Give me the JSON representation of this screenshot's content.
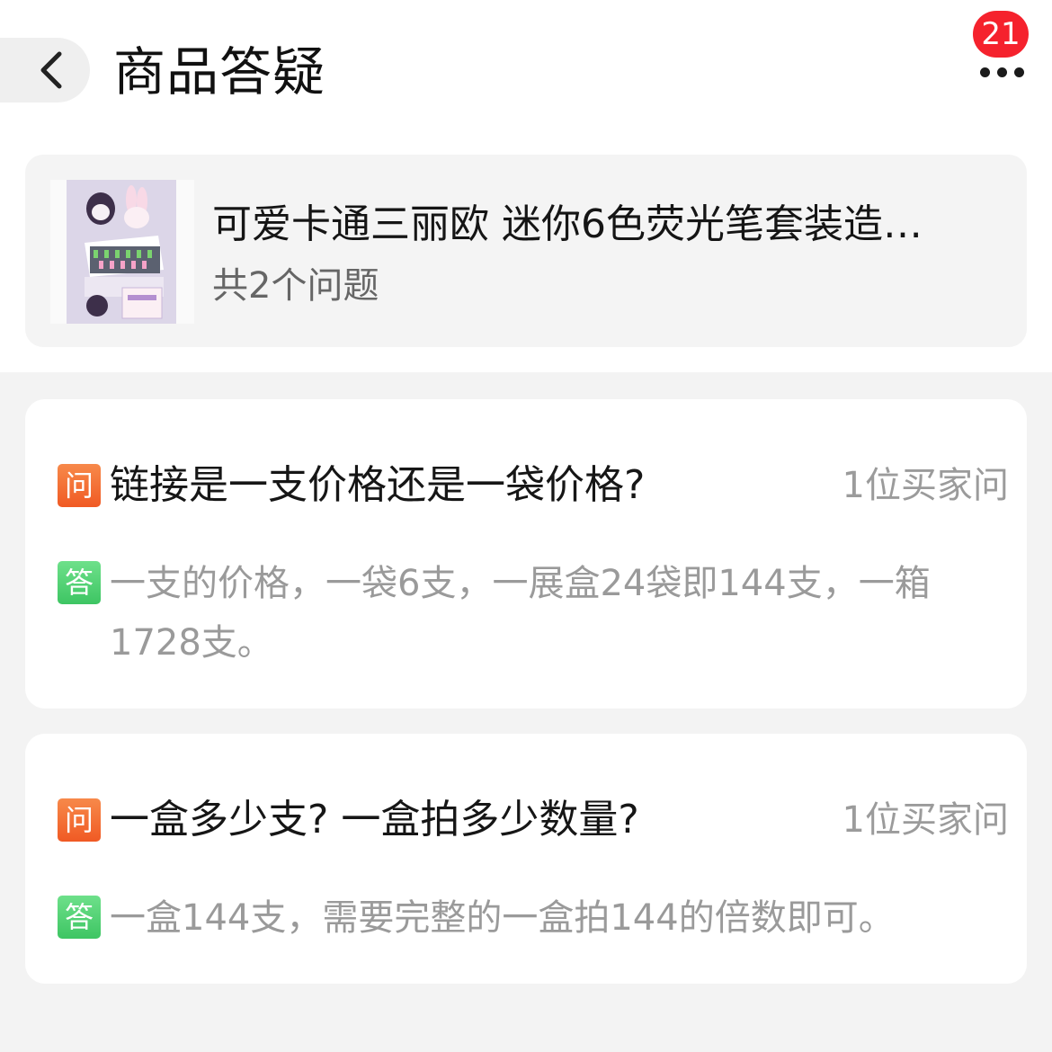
{
  "header": {
    "title": "商品答疑",
    "notification_count": "21"
  },
  "product": {
    "title": "可爱卡通三丽欧 迷你6色荧光笔套装造…",
    "question_count": "共2个问题"
  },
  "qa_items": [
    {
      "q_tag": "问",
      "question": "链接是一支价格还是一袋价格?",
      "asker": "1位买家问",
      "a_tag": "答",
      "answer": "一支的价格，一袋6支，一展盒24袋即144支，一箱1728支。"
    },
    {
      "q_tag": "问",
      "question": "一盒多少支? 一盒拍多少数量?",
      "asker": "1位买家问",
      "a_tag": "答",
      "answer": "一盒144支，需要完整的一盒拍144的倍数即可。"
    }
  ],
  "colors": {
    "badge": "#f5222d",
    "question_tag": "#f26a30",
    "answer_tag": "#4fd070"
  }
}
